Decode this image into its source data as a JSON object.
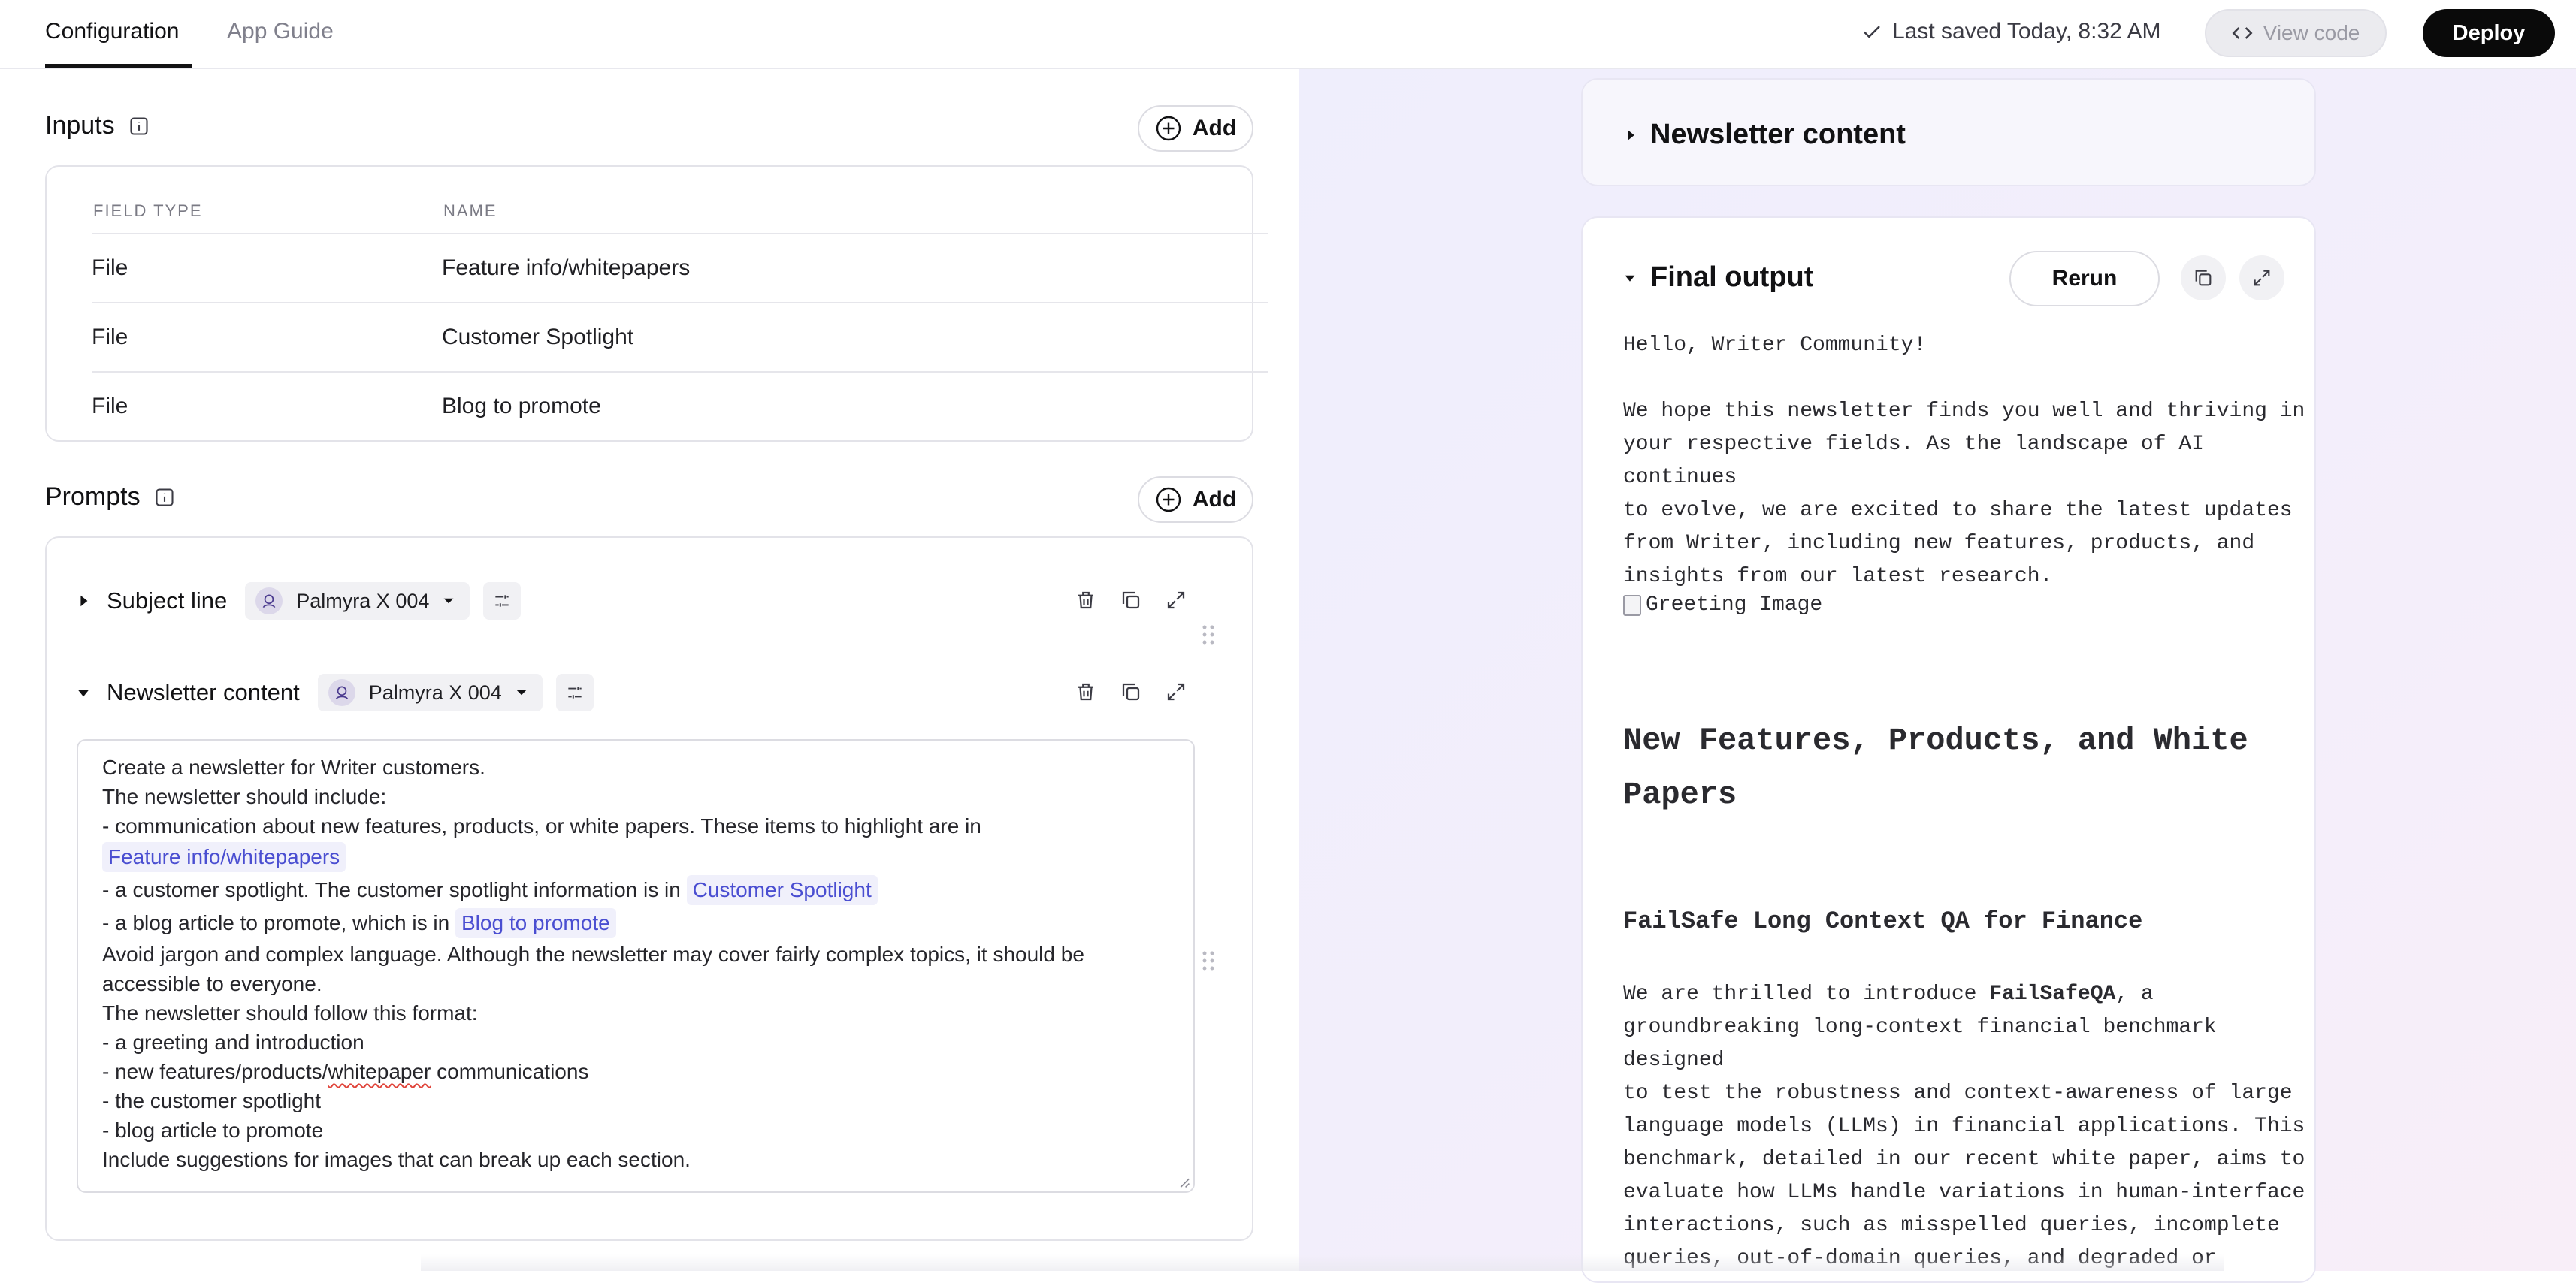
{
  "tabs": [
    {
      "label": "Configuration",
      "active": true
    },
    {
      "label": "App Guide",
      "active": false
    }
  ],
  "header": {
    "saved_status": "Last saved Today, 8:32 AM",
    "view_code_label": "View code",
    "deploy_label": "Deploy"
  },
  "inputs": {
    "title": "Inputs",
    "add_label": "Add",
    "columns": [
      "FIELD TYPE",
      "NAME"
    ],
    "rows": [
      {
        "type": "File",
        "name": "Feature info/whitepapers"
      },
      {
        "type": "File",
        "name": "Customer Spotlight"
      },
      {
        "type": "File",
        "name": "Blog to promote"
      }
    ]
  },
  "prompts": {
    "title": "Prompts",
    "add_label": "Add",
    "items": [
      {
        "title": "Subject line",
        "model": "Palmyra X 004",
        "expanded": false
      },
      {
        "title": "Newsletter content",
        "model": "Palmyra X 004",
        "expanded": true
      }
    ],
    "editor": {
      "line1": "Create a newsletter for Writer customers.",
      "line2": "The newsletter should include:",
      "line3": "- communication about new features, products, or white papers. These items to highlight are in",
      "chip1": "Feature info/whitepapers",
      "line4": "- a customer spotlight. The customer spotlight information is in",
      "chip2": "Customer Spotlight",
      "line5": "- a blog article to promote, which is in",
      "chip3": "Blog to promote",
      "line6": "Avoid jargon and complex language. Although the newsletter may cover fairly complex topics, it should be",
      "line7": "accessible to everyone.",
      "line8": "The newsletter should follow this format:",
      "line9": "- a greeting and introduction",
      "line10a": "- new features/products/",
      "line10b": "whitepaper",
      "line10c": " communications",
      "line11": "- the customer spotlight",
      "line12": "- blog article to promote",
      "line13": "Include suggestions for images that can break up each section."
    }
  },
  "output": {
    "collapsed_title": "Newsletter content",
    "final_title": "Final output",
    "rerun_label": "Rerun",
    "greeting": "Hello, Writer Community!",
    "intro": [
      "We hope this newsletter finds you well and thriving in",
      "your respective fields. As the landscape of AI continues",
      "to evolve, we are excited to share the latest updates",
      "from Writer, including new features, products, and",
      "insights from our latest research."
    ],
    "image_alt": "Greeting Image",
    "heading_lines": [
      "New Features, Products, and White",
      "Papers"
    ],
    "subheading": "FailSafe Long Context QA for Finance",
    "para_lead": "We are thrilled to introduce ",
    "para_bold": "FailSafeQA",
    "para_after": ", a",
    "para_lines": [
      "groundbreaking long-context financial benchmark designed",
      "to test the robustness and context-awareness of large",
      "language models (LLMs) in financial applications. This",
      "benchmark, detailed in our recent white paper, aims to",
      "evaluate how LLMs handle variations in human-interface",
      "interactions, such as misspelled queries, incomplete",
      "queries, out-of-domain queries, and degraded or"
    ]
  }
}
